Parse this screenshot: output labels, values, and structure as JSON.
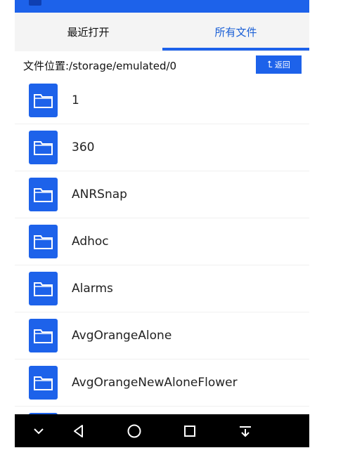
{
  "tabs": [
    {
      "label": "最近打开"
    },
    {
      "label": "所有文件"
    }
  ],
  "path": {
    "label": "文件位置:/storage/emulated/0",
    "back_label": "返回"
  },
  "folders": [
    {
      "name": "1"
    },
    {
      "name": "360"
    },
    {
      "name": "ANRSnap"
    },
    {
      "name": "Adhoc"
    },
    {
      "name": "Alarms"
    },
    {
      "name": "AvgOrangeAlone"
    },
    {
      "name": "AvgOrangeNewAloneFlower"
    },
    {
      "name": ""
    }
  ],
  "colors": {
    "accent": "#1d62ea",
    "tab_active_text": "#1a5fd6",
    "navbar": "#000000"
  },
  "icons": {
    "folder": "folder-icon",
    "back": "return-arrow-icon",
    "nav": [
      "chevron-down-icon",
      "back-triangle-icon",
      "home-circle-icon",
      "recents-square-icon",
      "notification-pull-icon"
    ]
  }
}
